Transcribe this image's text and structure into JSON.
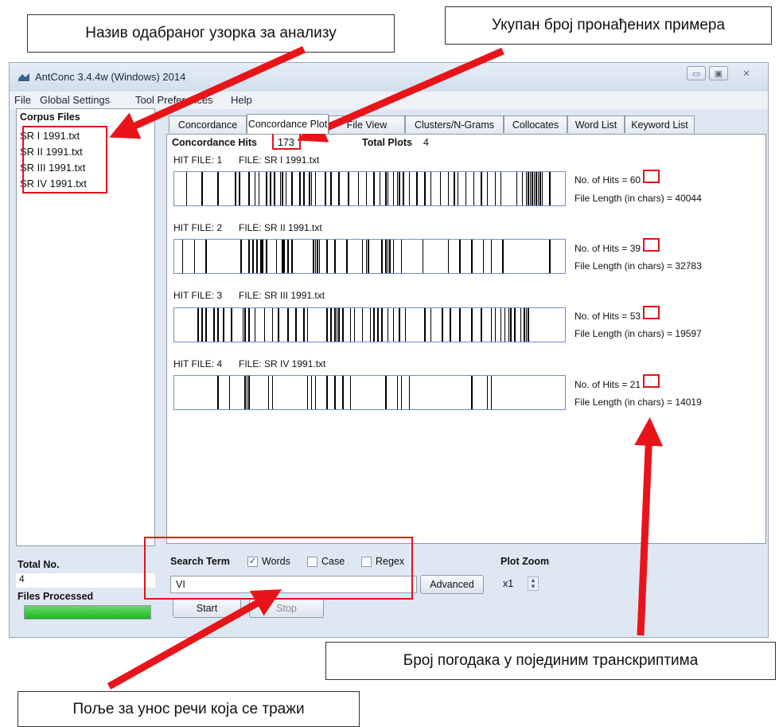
{
  "callouts": {
    "sample_name": "Назив одабраног узорка за анализу",
    "total_found": "Укупан број пронађених примера",
    "hits_per_transcript": "Број погодака у појединим транскриптима",
    "search_field": "Поље за унос речи која се тражи"
  },
  "window": {
    "title": "AntConc 3.4.4w (Windows) 2014",
    "minimize_icon": "▭",
    "maximize_icon": "▣",
    "close_icon": "✕"
  },
  "menu": [
    "File",
    "Global Settings",
    "Tool Preferences",
    "Help"
  ],
  "corpus": {
    "header": "Corpus Files",
    "files": [
      "SR I 1991.txt",
      "SR II 1991.txt",
      "SR III 1991.txt",
      "SR IV 1991.txt"
    ],
    "total_label": "Total No.",
    "total_value": "4",
    "processed_label": "Files Processed",
    "progress": 1.0
  },
  "tabs": [
    "Concordance",
    "Concordance Plot",
    "File View",
    "Clusters/N-Grams",
    "Collocates",
    "Word List",
    "Keyword List"
  ],
  "plot": {
    "hits_label": "Concordance Hits",
    "hits_value": "173",
    "total_plots_label": "Total Plots",
    "total_plots_value": "4",
    "hits_prefix": "No. of Hits = ",
    "length_prefix": "File Length (in chars) = ",
    "files": [
      {
        "hit_file": "HIT FILE: 1",
        "file": "FILE: SR I 1991.txt",
        "hits": "60",
        "length": "40044",
        "positions": [
          0.03,
          0.07,
          0.11,
          0.155,
          0.165,
          0.19,
          0.205,
          0.215,
          0.235,
          0.245,
          0.255,
          0.27,
          0.275,
          0.285,
          0.3,
          0.32,
          0.33,
          0.345,
          0.35,
          0.36,
          0.385,
          0.4,
          0.42,
          0.445,
          0.47,
          0.49,
          0.51,
          0.525,
          0.54,
          0.545,
          0.56,
          0.57,
          0.575,
          0.585,
          0.6,
          0.62,
          0.64,
          0.655,
          0.68,
          0.7,
          0.715,
          0.725,
          0.745,
          0.765,
          0.785,
          0.8,
          0.82,
          0.835,
          0.875,
          0.89,
          0.9,
          0.905,
          0.91,
          0.915,
          0.92,
          0.925,
          0.93,
          0.935,
          0.94,
          0.96
        ]
      },
      {
        "hit_file": "HIT FILE: 2",
        "file": "FILE: SR II 1991.txt",
        "hits": "39",
        "length": "32783",
        "positions": [
          0.02,
          0.05,
          0.08,
          0.17,
          0.19,
          0.2,
          0.21,
          0.22,
          0.225,
          0.235,
          0.26,
          0.275,
          0.28,
          0.29,
          0.3,
          0.355,
          0.36,
          0.365,
          0.37,
          0.39,
          0.41,
          0.44,
          0.48,
          0.49,
          0.495,
          0.53,
          0.54,
          0.545,
          0.55,
          0.56,
          0.58,
          0.635,
          0.7,
          0.73,
          0.76,
          0.79,
          0.81,
          0.84,
          0.96
        ]
      },
      {
        "hit_file": "HIT FILE: 3",
        "file": "FILE: SR III 1991.txt",
        "hits": "53",
        "length": "19597",
        "positions": [
          0.06,
          0.07,
          0.08,
          0.1,
          0.11,
          0.125,
          0.145,
          0.175,
          0.18,
          0.19,
          0.205,
          0.23,
          0.25,
          0.265,
          0.29,
          0.31,
          0.33,
          0.34,
          0.39,
          0.4,
          0.41,
          0.415,
          0.42,
          0.43,
          0.45,
          0.46,
          0.48,
          0.5,
          0.51,
          0.52,
          0.53,
          0.545,
          0.56,
          0.575,
          0.59,
          0.64,
          0.655,
          0.685,
          0.705,
          0.73,
          0.76,
          0.785,
          0.81,
          0.82,
          0.835,
          0.845,
          0.855,
          0.86,
          0.87,
          0.885,
          0.895,
          0.9,
          0.905
        ]
      },
      {
        "hit_file": "HIT FILE: 4",
        "file": "FILE: SR IV 1991.txt",
        "hits": "21",
        "length": "14019",
        "positions": [
          0.11,
          0.14,
          0.18,
          0.185,
          0.19,
          0.24,
          0.25,
          0.34,
          0.35,
          0.36,
          0.39,
          0.41,
          0.43,
          0.45,
          0.54,
          0.57,
          0.58,
          0.6,
          0.76,
          0.8,
          0.81
        ]
      }
    ]
  },
  "search": {
    "term_label": "Search Term",
    "words_label": "Words",
    "words_checked": true,
    "case_label": "Case",
    "regex_label": "Regex",
    "value": "VI",
    "advanced_label": "Advanced",
    "start_label": "Start",
    "stop_label": "Stop",
    "zoom_label": "Plot Zoom",
    "zoom_value": "x1"
  }
}
